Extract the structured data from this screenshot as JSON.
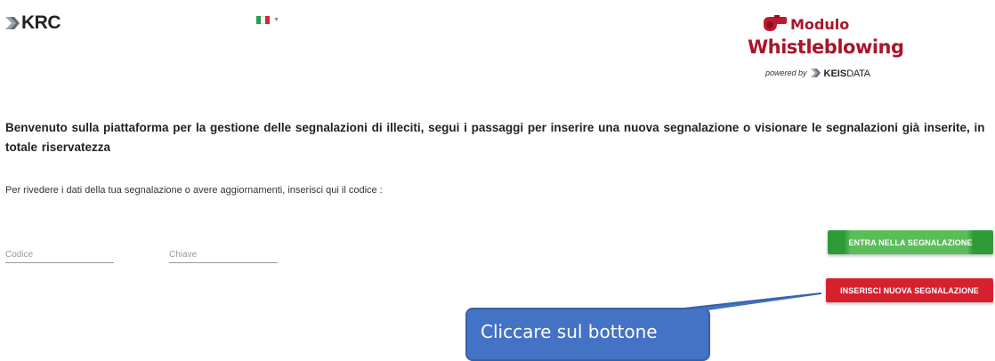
{
  "header": {
    "brand_text": "KRC",
    "language": {
      "flag": "it",
      "selected": "Italiano"
    },
    "module_logo": {
      "title_line1": "Modulo",
      "title_line2": "Whistleblowing",
      "powered_by": "powered by",
      "vendor_bold": "KEIS",
      "vendor_light": "DATA"
    }
  },
  "main": {
    "welcome_text": "Benvenuto sulla piattaforma per la gestione delle segnalazioni di illeciti, segui i passaggi per inserire una nuova segnalazione o visionare le segnalazioni già inserite, in totale riservatezza",
    "instruction_text": "Per rivedere i dati della tua segnalazione o avere aggiornamenti, inserisci qui il codice :",
    "code_field": {
      "placeholder": "Codice",
      "value": ""
    },
    "key_field": {
      "placeholder": "Chiave",
      "value": ""
    },
    "enter_button_label": "ENTRA NELLA SEGNALAZIONE",
    "new_button_label": "INSERISCI NUOVA SEGNALAZIONE"
  },
  "annotation": {
    "callout_text": "Cliccare sul bottone"
  },
  "colors": {
    "brand_red": "#a8152a",
    "enter_green": "#5bbd5a",
    "new_red": "#d7202e",
    "callout_blue": "#4472c4"
  }
}
